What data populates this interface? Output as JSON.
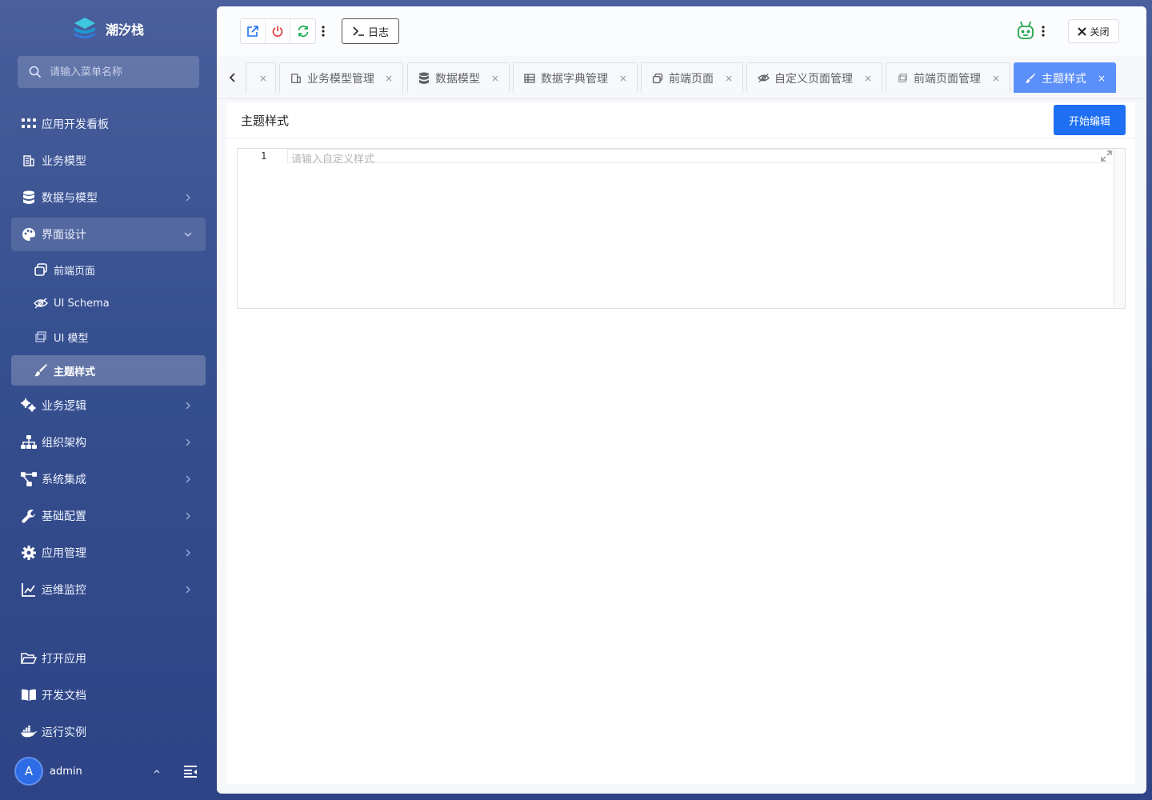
{
  "brand": {
    "name": "潮汐栈"
  },
  "search": {
    "placeholder": "请输入菜单名称"
  },
  "menu": {
    "items": [
      {
        "label": "应用开发看板"
      },
      {
        "label": "业务模型"
      },
      {
        "label": "数据与模型"
      },
      {
        "label": "界面设计"
      }
    ],
    "sub_items": [
      {
        "label": "前端页面"
      },
      {
        "label": "UI Schema"
      },
      {
        "label": "UI 模型"
      },
      {
        "label": "主题样式"
      }
    ],
    "items_after": [
      {
        "label": "业务逻辑"
      },
      {
        "label": "组织架构"
      },
      {
        "label": "系统集成"
      },
      {
        "label": "基础配置"
      },
      {
        "label": "应用管理"
      },
      {
        "label": "运维监控"
      }
    ],
    "bottom": [
      {
        "label": "打开应用"
      },
      {
        "label": "开发文档"
      },
      {
        "label": "运行实例"
      }
    ]
  },
  "user": {
    "avatar_letter": "A",
    "name": "admin"
  },
  "toolbar": {
    "log_label": "日志",
    "close_label": "关闭"
  },
  "tabs": [
    {
      "label": "业务模型管理"
    },
    {
      "label": "数据模型"
    },
    {
      "label": "数据字典管理"
    },
    {
      "label": "前端页面"
    },
    {
      "label": "自定义页面管理"
    },
    {
      "label": "前端页面管理"
    },
    {
      "label": "主题样式",
      "active": true
    }
  ],
  "tab_close": "×",
  "page": {
    "title": "主题样式",
    "edit_label": "开始编辑"
  },
  "editor": {
    "line_number": "1",
    "placeholder": "请输入自定义样式"
  },
  "colors": {
    "accent": "#1e6ff1",
    "tab_active": "#5b8ff9",
    "sidebar": "#3a5090"
  }
}
